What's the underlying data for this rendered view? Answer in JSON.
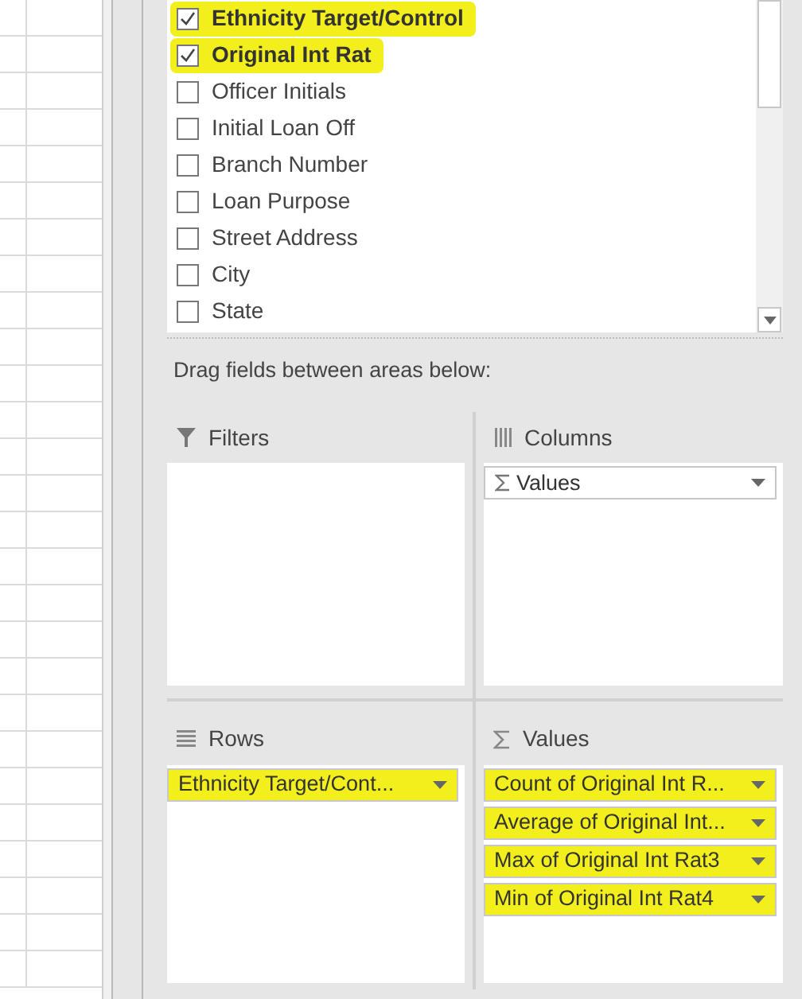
{
  "field_list": [
    {
      "label": "Ethnicity Target/Control",
      "checked": true,
      "highlighted": true
    },
    {
      "label": "Original Int Rat",
      "checked": true,
      "highlighted": true
    },
    {
      "label": "Officer Initials",
      "checked": false,
      "highlighted": false
    },
    {
      "label": "Initial Loan Off",
      "checked": false,
      "highlighted": false
    },
    {
      "label": "Branch Number",
      "checked": false,
      "highlighted": false
    },
    {
      "label": "Loan Purpose",
      "checked": false,
      "highlighted": false
    },
    {
      "label": "Street Address",
      "checked": false,
      "highlighted": false
    },
    {
      "label": "City",
      "checked": false,
      "highlighted": false
    },
    {
      "label": "State",
      "checked": false,
      "highlighted": false
    }
  ],
  "areas_heading": "Drag fields between areas below:",
  "areas": [
    {
      "kind": "filters",
      "title": "Filters"
    },
    {
      "kind": "columns",
      "title": "Columns",
      "items": [
        {
          "label": "Values",
          "kind": "sigma",
          "highlighted": false
        }
      ]
    },
    {
      "kind": "rows",
      "title": "Rows",
      "items": [
        {
          "label": "Ethnicity Target/Cont...",
          "kind": "plain",
          "highlighted": true
        }
      ]
    },
    {
      "kind": "values",
      "title": "Values",
      "items": [
        {
          "label": "Count of Original Int R...",
          "kind": "plain",
          "highlighted": true
        },
        {
          "label": "Average of Original Int...",
          "kind": "plain",
          "highlighted": true
        },
        {
          "label": "Max of Original Int Rat3",
          "kind": "plain",
          "highlighted": true
        },
        {
          "label": "Min of Original Int Rat4",
          "kind": "plain",
          "highlighted": true
        }
      ]
    }
  ]
}
